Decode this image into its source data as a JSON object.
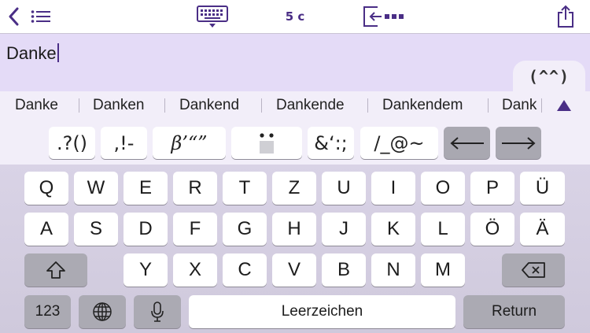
{
  "toolbar": {
    "char_count": "5 c",
    "icons": [
      "chevron-left-icon",
      "list-icon",
      "keyboard-dismiss-icon",
      "move-cursor-icon",
      "share-icon"
    ]
  },
  "editor": {
    "text": "Danke",
    "emoticon_tab": "(^^)"
  },
  "suggestions": {
    "items": [
      "Danke",
      "Danken",
      "Dankend",
      "Dankende",
      "Dankendem",
      "Dank"
    ],
    "expand_icon": "triangle-up-icon"
  },
  "symbols": {
    "keys": [
      ".?()",
      ",!-",
      "β’“”",
      "̈",
      "&‘:;",
      "/_@~",
      "⟵",
      "⟶"
    ]
  },
  "keyboard": {
    "row1": [
      "Q",
      "W",
      "E",
      "R",
      "T",
      "Z",
      "U",
      "I",
      "O",
      "P",
      "Ü"
    ],
    "row2": [
      "A",
      "S",
      "D",
      "F",
      "G",
      "H",
      "J",
      "K",
      "L",
      "Ö",
      "Ä"
    ],
    "row3": [
      "Y",
      "X",
      "C",
      "V",
      "B",
      "N",
      "M"
    ],
    "numbers_label": "123",
    "space_label": "Leerzeichen",
    "return_label": "Return"
  },
  "colors": {
    "accent": "#4a2e86",
    "text_area_bg": "#e4dbf7",
    "keyboard_bg": "#d6d0e3"
  }
}
